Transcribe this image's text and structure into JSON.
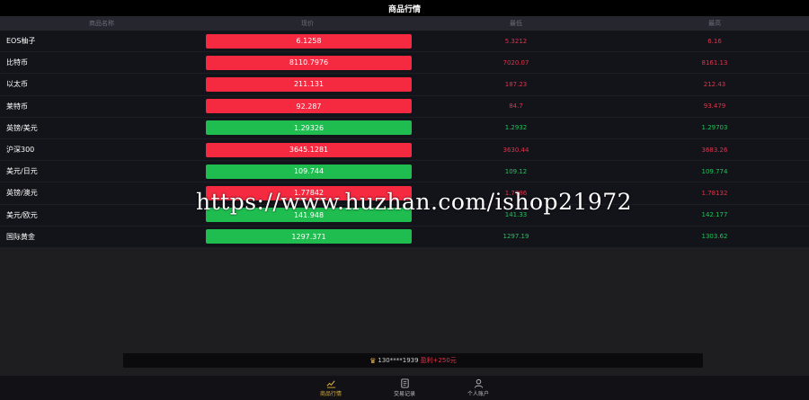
{
  "header": {
    "title": "商品行情"
  },
  "columns": {
    "name": "商品名称",
    "price": "现价",
    "low": "最低",
    "high": "最高"
  },
  "rows": [
    {
      "name": "EOS柚子",
      "price": "6.1258",
      "trend": "up",
      "low": "5.3212",
      "high": "6.16"
    },
    {
      "name": "比特币",
      "price": "8110.7976",
      "trend": "up",
      "low": "7020.07",
      "high": "8161.13"
    },
    {
      "name": "以太币",
      "price": "211.131",
      "trend": "up",
      "low": "187.23",
      "high": "212.43"
    },
    {
      "name": "莱特币",
      "price": "92.287",
      "trend": "up",
      "low": "84.7",
      "high": "93.479"
    },
    {
      "name": "英镑/美元",
      "price": "1.29326",
      "trend": "down",
      "low": "1.2932",
      "high": "1.29703"
    },
    {
      "name": "沪深300",
      "price": "3645.1281",
      "trend": "up",
      "low": "3630.44",
      "high": "3683.26"
    },
    {
      "name": "美元/日元",
      "price": "109.744",
      "trend": "down",
      "low": "109.12",
      "high": "109.774"
    },
    {
      "name": "英镑/澳元",
      "price": "1.77842",
      "trend": "up",
      "low": "1.7786",
      "high": "1.78132"
    },
    {
      "name": "美元/欧元",
      "price": "141.948",
      "trend": "down",
      "low": "141.33",
      "high": "142.177"
    },
    {
      "name": "国际黄金",
      "price": "1297.371",
      "trend": "down",
      "low": "1297.19",
      "high": "1303.62"
    }
  ],
  "ticker": {
    "user": "130****1939",
    "profit": "盈利+250元"
  },
  "nav": [
    {
      "label": "商品行情",
      "active": true
    },
    {
      "label": "交易记录",
      "active": false
    },
    {
      "label": "个人账户",
      "active": false
    }
  ],
  "watermark": "https://www.huzhan.com/ishop21972",
  "colors": {
    "up": "#f5293f",
    "down": "#1fbd4f",
    "accent": "#d4a93a"
  }
}
